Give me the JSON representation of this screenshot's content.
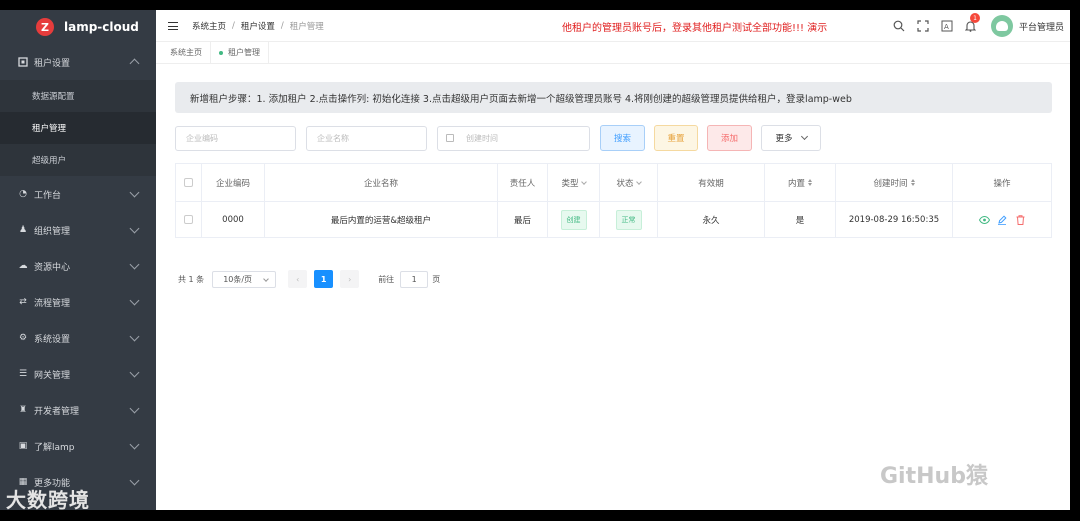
{
  "app": {
    "name": "lamp-cloud",
    "logo_letter": "Z"
  },
  "sidebar": {
    "groups": [
      {
        "label": "租户设置",
        "icon": "grid-icon",
        "expanded": true,
        "items": [
          {
            "label": "数据源配置"
          },
          {
            "label": "租户管理",
            "active": true
          },
          {
            "label": "超级用户"
          }
        ]
      },
      {
        "label": "工作台",
        "icon": "dashboard-icon"
      },
      {
        "label": "组织管理",
        "icon": "users-icon"
      },
      {
        "label": "资源中心",
        "icon": "cloud-icon"
      },
      {
        "label": "流程管理",
        "icon": "flow-icon"
      },
      {
        "label": "系统设置",
        "icon": "gears-icon"
      },
      {
        "label": "网关管理",
        "icon": "gateway-icon"
      },
      {
        "label": "开发者管理",
        "icon": "developer-icon"
      },
      {
        "label": "了解lamp",
        "icon": "info-icon"
      },
      {
        "label": "更多功能",
        "icon": "apps-icon"
      }
    ]
  },
  "header": {
    "breadcrumb": [
      "系统主页",
      "租户设置",
      "租户管理"
    ],
    "notice": "他租户的管理员账号后，登录其他租户测试全部功能!!! 演示",
    "notification_count": "1",
    "user_name": "平台管理员"
  },
  "tabs": [
    {
      "label": "系统主页"
    },
    {
      "label": "租户管理",
      "active": true
    }
  ],
  "tip": "新增租户步骤：1. 添加租户 2.点击操作列: 初始化连接 3.点击超级用户页面去新增一个超级管理员账号 4.将刚创建的超级管理员提供给租户，登录lamp-web",
  "filters": {
    "code_placeholder": "企业编码",
    "name_placeholder": "企业名称",
    "date_placeholder": "创建时间",
    "search_label": "搜索",
    "reset_label": "重置",
    "add_label": "添加",
    "more_label": "更多"
  },
  "table": {
    "columns": [
      "企业编码",
      "企业名称",
      "责任人",
      "类型",
      "状态",
      "有效期",
      "内置",
      "创建时间",
      "操作"
    ],
    "rows": [
      {
        "code": "0000",
        "name": "最后内置的运营&超级租户",
        "owner": "最后",
        "type": "创建",
        "status": "正常",
        "validity": "永久",
        "builtin": "是",
        "created": "2019-08-29 16:50:35"
      }
    ]
  },
  "pagination": {
    "total_text": "共 1 条",
    "page_size": "10条/页",
    "current_page": "1",
    "goto_label": "前往",
    "goto_value": "1",
    "page_unit": "页"
  },
  "watermarks": {
    "left": "大数跨境",
    "right": "GitHub猿"
  },
  "colors": {
    "sidebar_bg": "#343b44",
    "primary": "#1890ff",
    "danger": "#f56c6c",
    "success": "#42b983"
  }
}
